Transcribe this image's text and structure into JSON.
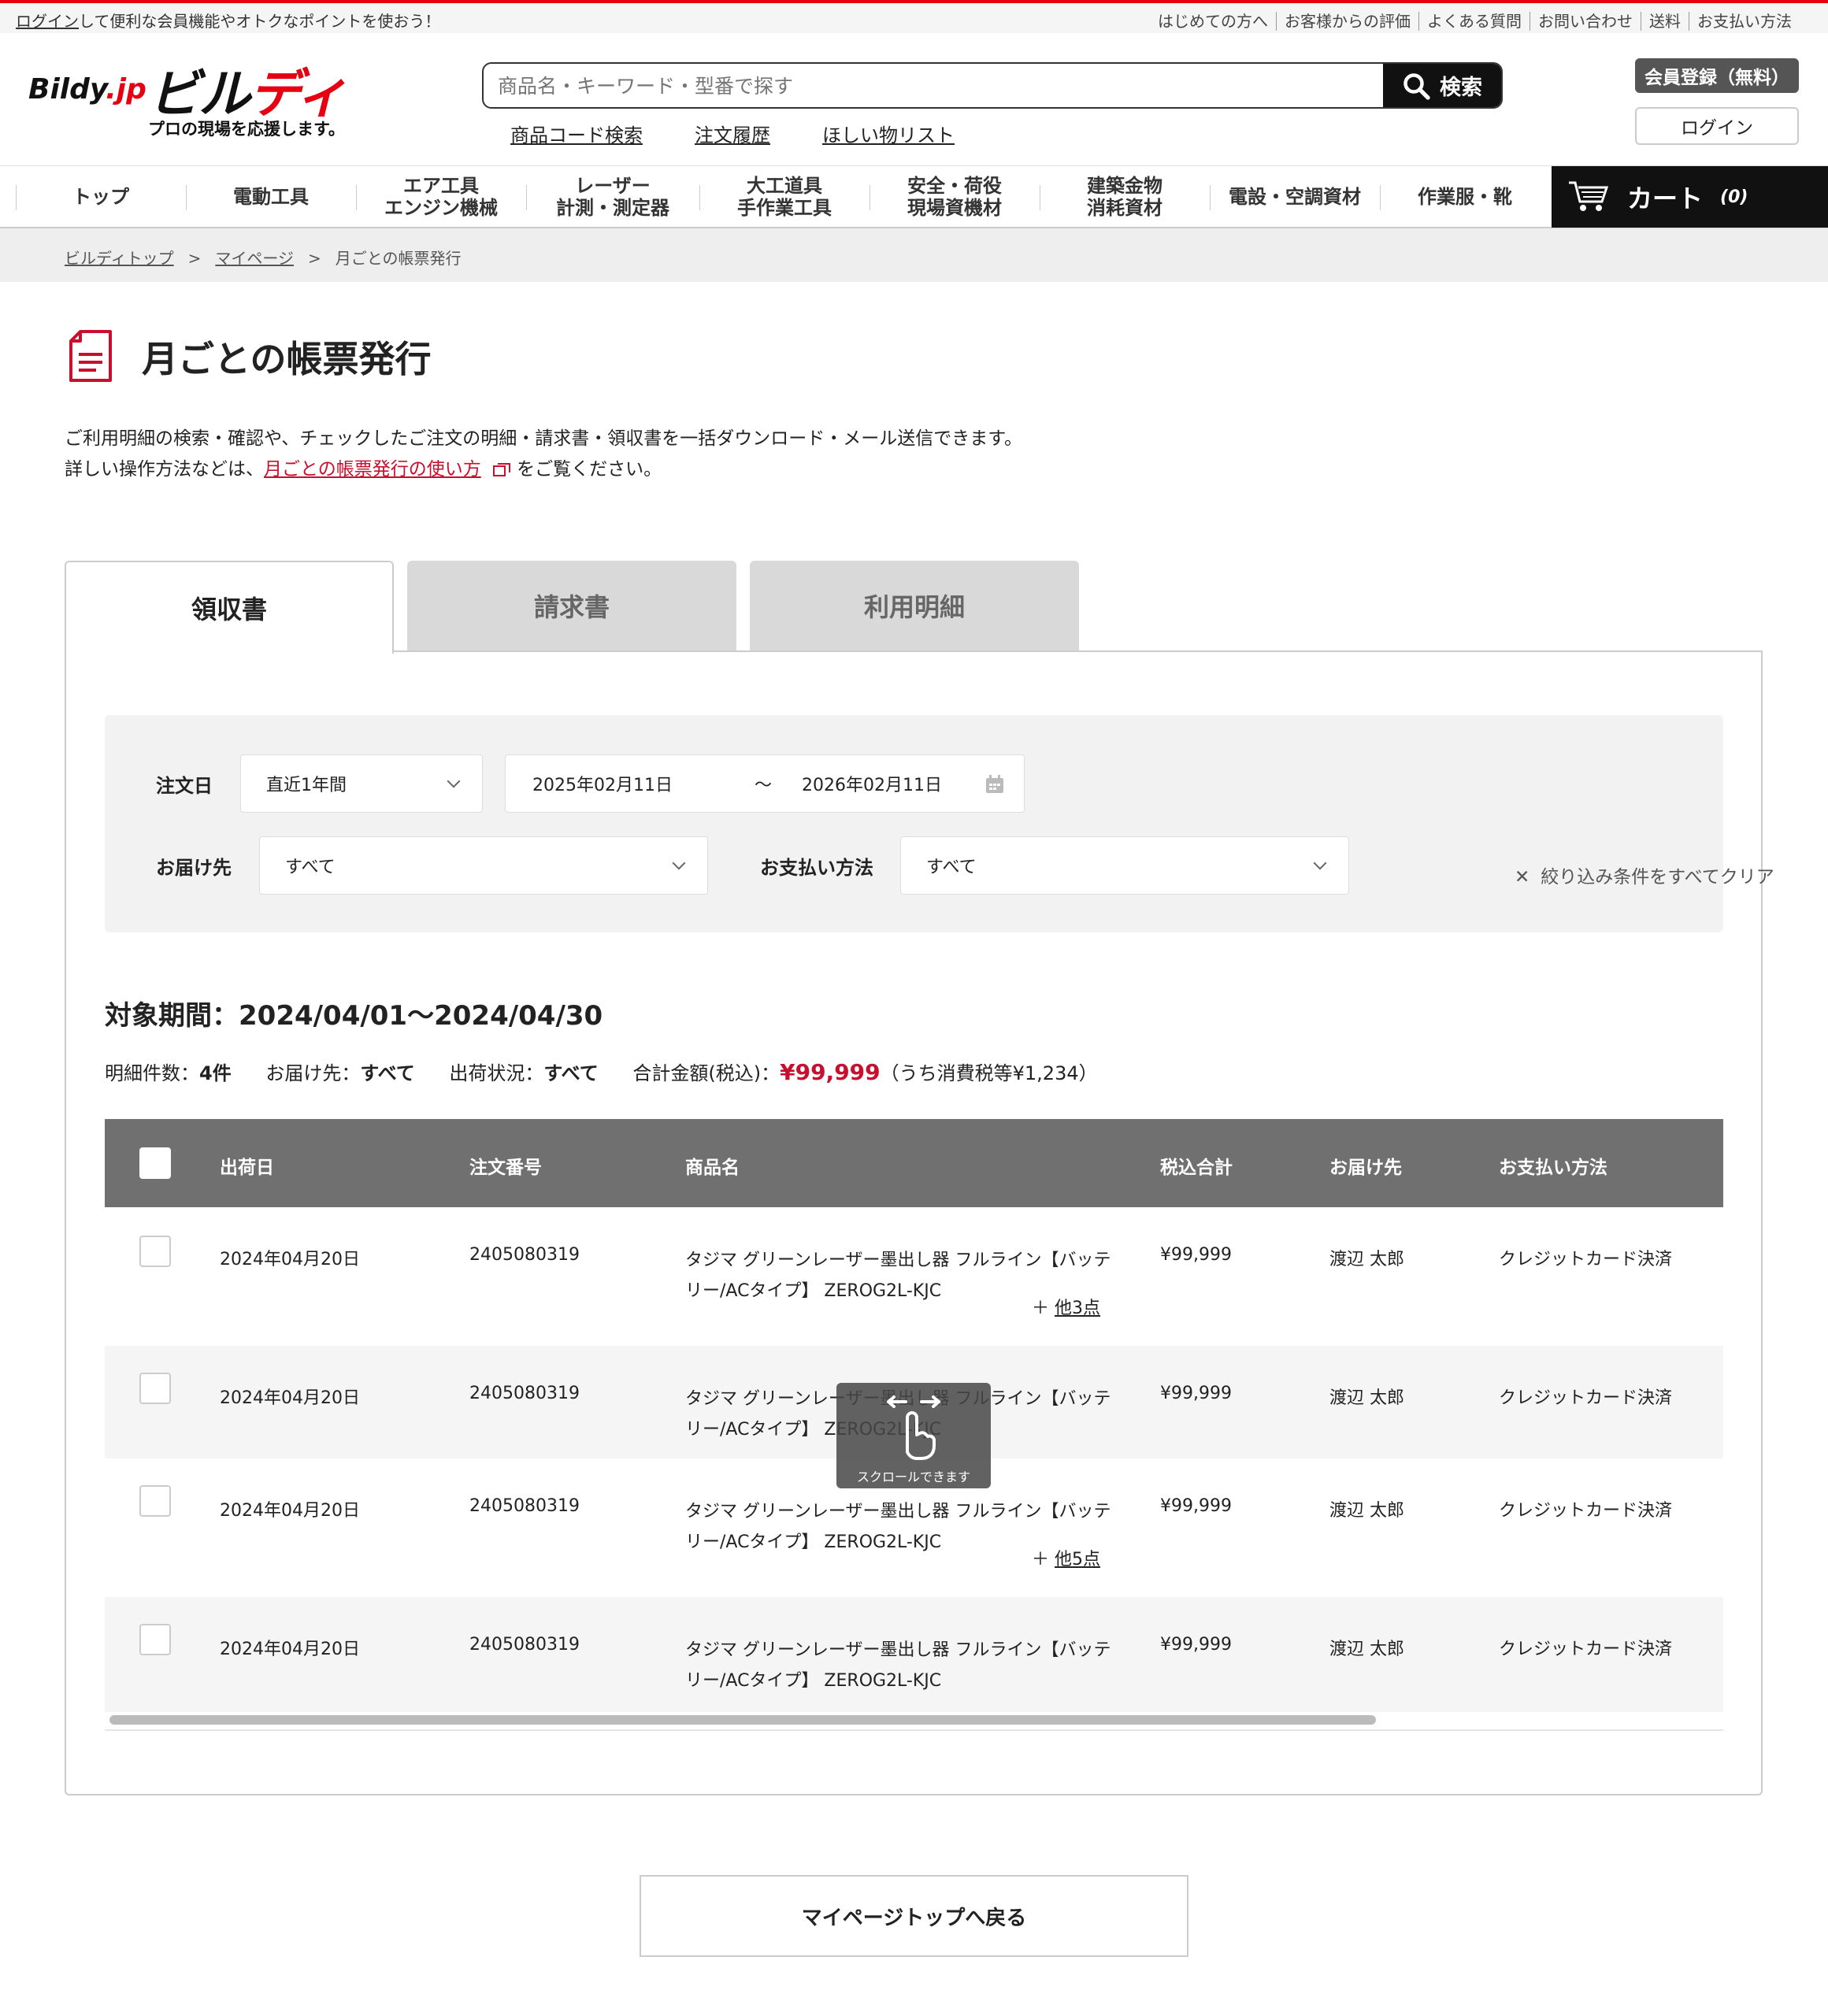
{
  "topbar": {
    "login_link": "ログイン",
    "login_msg": "して便利な会員機能やオトクなポイントを使おう！",
    "links": [
      "はじめての方へ",
      "お客様からの評価",
      "よくある質問",
      "お問い合わせ",
      "送料",
      "お支払い方法"
    ]
  },
  "header": {
    "logo_en": "Bildy",
    "logo_jp_suffix": ".jp",
    "logo_kana_a": "ビル",
    "logo_kana_b": "ディ",
    "tagline": "プロの現場を応援します。",
    "search_placeholder": "商品名・キーワード・型番で探す",
    "search_button": "検索",
    "sublinks": [
      "商品コード検索",
      "注文履歴",
      "ほしい物リスト"
    ],
    "register_button": "会員登録（無料）",
    "login_button": "ログイン"
  },
  "nav": {
    "items": [
      "トップ",
      "電動工具",
      "エア工具\nエンジン機械",
      "レーザー\n計測・測定器",
      "大工道具\n手作業工具",
      "安全・荷役\n現場資機材",
      "建築金物\n消耗資材",
      "電設・空調資材",
      "作業服・靴"
    ],
    "cart_label": "カート",
    "cart_count": "(0)"
  },
  "breadcrumb": [
    "ビルディトップ",
    "マイページ",
    "月ごとの帳票発行"
  ],
  "page": {
    "title": "月ごとの帳票発行",
    "intro_line1": "ご利用明細の検索・確認や、チェックしたご注文の明細・請求書・領収書を一括ダウンロード・メール送信できます。",
    "intro_line2_a": "詳しい操作方法などは、",
    "intro_link": "月ごとの帳票発行の使い方",
    "intro_line2_b": "をご覧ください。"
  },
  "tabs": [
    "領収書",
    "請求書",
    "利用明細"
  ],
  "filter": {
    "order_date_label": "注文日",
    "period_value": "直近1年間",
    "date_from": "2025年02月11日",
    "tilde": "〜",
    "date_to": "2026年02月11日",
    "dest_label": "お届け先",
    "dest_value": "すべて",
    "pay_label": "お支払い方法",
    "pay_value": "すべて",
    "clear_label": "絞り込み条件をすべてクリア"
  },
  "summary": {
    "period_label": "対象期間：",
    "period_value": "2024/04/01〜2024/04/30",
    "count_label": "明細件数：",
    "count_value": "4件",
    "dest_label": "お届け先：",
    "dest_value": "すべて",
    "ship_label": "出荷状況：",
    "ship_value": "すべて",
    "total_label": "合計金額(税込)：",
    "total_value": "¥99,999",
    "tax_note": "（うち消費税等¥1,234）"
  },
  "table": {
    "headers": [
      "出荷日",
      "注文番号",
      "商品名",
      "税込合計",
      "お届け先",
      "お支払い方法"
    ],
    "rows": [
      {
        "date": "2024年04月20日",
        "order": "2405080319",
        "product": "タジマ グリーンレーザー墨出し器 フルライン【バッテリー/ACタイプ】 ZEROG2L-KJC",
        "more": "他3点",
        "total": "¥99,999",
        "dest": "渡辺 太郎",
        "pay": "クレジットカード決済"
      },
      {
        "date": "2024年04月20日",
        "order": "2405080319",
        "product": "タジマ グリーンレーザー墨出し器 フルライン【バッテリー/ACタイプ】 ZEROG2L-KJC",
        "more": "",
        "total": "¥99,999",
        "dest": "渡辺 太郎",
        "pay": "クレジットカード決済"
      },
      {
        "date": "2024年04月20日",
        "order": "2405080319",
        "product": "タジマ グリーンレーザー墨出し器 フルライン【バッテリー/ACタイプ】 ZEROG2L-KJC",
        "more": "他5点",
        "total": "¥99,999",
        "dest": "渡辺 太郎",
        "pay": "クレジットカード決済"
      },
      {
        "date": "2024年04月20日",
        "order": "2405080319",
        "product": "タジマ グリーンレーザー墨出し器 フルライン【バッテリー/ACタイプ】 ZEROG2L-KJC",
        "more": "",
        "total": "¥99,999",
        "dest": "渡辺 太郎",
        "pay": "クレジットカード決済"
      }
    ],
    "scroll_hint": "スクロールできます"
  },
  "back_button": "マイページトップへ戻る",
  "colors": {
    "accent": "#e50012",
    "link_red": "#c8102e",
    "table_header": "#707070"
  }
}
